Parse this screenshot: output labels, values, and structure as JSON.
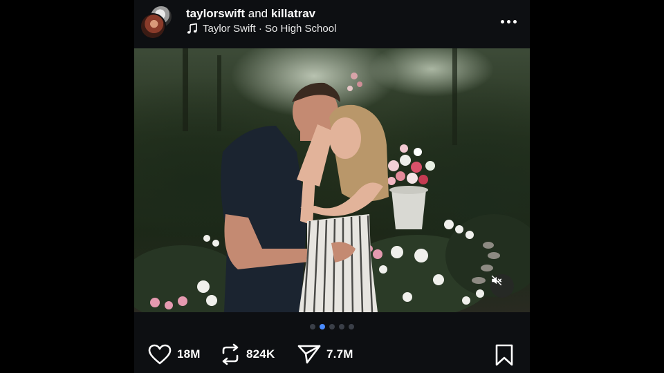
{
  "post": {
    "author": "taylorswift",
    "conjunction": "and",
    "collaborator": "killatrav",
    "audio": "Taylor Swift · So High School"
  },
  "icons": {
    "music": "music-note-icon",
    "more": "more-options-icon",
    "mute": "muted-speaker-icon",
    "like": "heart-icon",
    "repost": "repost-icon",
    "share": "send-icon",
    "save": "bookmark-icon"
  },
  "carousel": {
    "slides": 5,
    "current": 2,
    "active_color": "#4a8cff"
  },
  "actions": {
    "likes": "18M",
    "reposts": "824K",
    "shares": "7.7M"
  }
}
